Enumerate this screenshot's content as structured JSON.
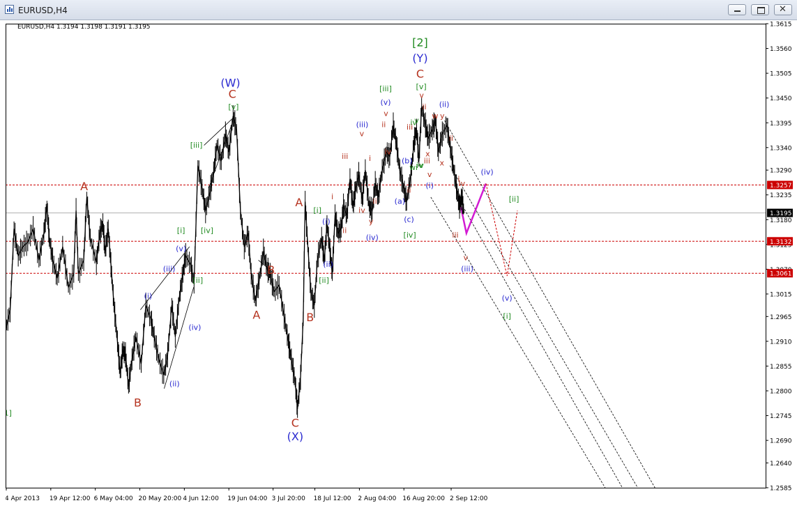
{
  "window": {
    "title": "EURUSD,H4"
  },
  "chart_header": {
    "label": "EURUSD,H4  1.3194 1.3198 1.3191 1.3195"
  },
  "colors": {
    "red": "#b5331f",
    "blue": "#2a2ad0",
    "green": "#228b22",
    "magenta": "#d21ad2",
    "price": "#000000",
    "hline": "#cc0000",
    "current": "#b0b0b0"
  },
  "chart_data": {
    "type": "line",
    "series": [
      {
        "values": [
          [
            0,
            1.2935
          ],
          [
            1.2,
            1.298
          ],
          [
            2.2,
            1.316
          ],
          [
            3.3,
            1.31
          ],
          [
            4.5,
            1.312
          ],
          [
            5.8,
            1.313
          ],
          [
            7.2,
            1.316
          ],
          [
            8.7,
            1.309
          ],
          [
            10.0,
            1.315
          ],
          [
            10.8,
            1.321
          ],
          [
            11.4,
            1.314
          ],
          [
            12.3,
            1.309
          ],
          [
            13.5,
            1.305
          ],
          [
            14.9,
            1.312
          ],
          [
            16.4,
            1.303
          ],
          [
            17.8,
            1.306
          ],
          [
            18.4,
            1.32
          ],
          [
            19.0,
            1.306
          ],
          [
            20.4,
            1.309
          ],
          [
            21.2,
            1.323
          ],
          [
            22.1,
            1.314
          ],
          [
            23.7,
            1.3085
          ],
          [
            24.6,
            1.315
          ],
          [
            25.4,
            1.317
          ],
          [
            26.0,
            1.311
          ],
          [
            26.8,
            1.316
          ],
          [
            27.5,
            1.308
          ],
          [
            28.3,
            1.299
          ],
          [
            29.2,
            1.291
          ],
          [
            29.9,
            1.284
          ],
          [
            30.6,
            1.289
          ],
          [
            31.3,
            1.288
          ],
          [
            32.1,
            1.281
          ],
          [
            33.0,
            1.287
          ],
          [
            34.0,
            1.292
          ],
          [
            35.4,
            1.286
          ],
          [
            36.6,
            1.299
          ],
          [
            37.9,
            1.296
          ],
          [
            38.8,
            1.292
          ],
          [
            40.0,
            1.287
          ],
          [
            41.3,
            1.2835
          ],
          [
            42.3,
            1.288
          ],
          [
            43.4,
            1.299
          ],
          [
            44.3,
            1.292
          ],
          [
            45.4,
            1.301
          ],
          [
            46.3,
            1.306
          ],
          [
            47.0,
            1.31
          ],
          [
            48.3,
            1.308
          ],
          [
            49.2,
            1.304
          ],
          [
            50.2,
            1.33
          ],
          [
            51.3,
            1.325
          ],
          [
            52.2,
            1.32
          ],
          [
            53.3,
            1.324
          ],
          [
            54.3,
            1.3285
          ],
          [
            55.2,
            1.3345
          ],
          [
            56.3,
            1.331
          ],
          [
            57.4,
            1.337
          ],
          [
            58.3,
            1.333
          ],
          [
            59.4,
            1.341
          ],
          [
            60.3,
            1.338
          ],
          [
            61.3,
            1.32
          ],
          [
            62.3,
            1.312
          ],
          [
            63.3,
            1.315
          ],
          [
            64.1,
            1.306
          ],
          [
            65.2,
            1.3
          ],
          [
            66.2,
            1.3045
          ],
          [
            67.3,
            1.311
          ],
          [
            68.3,
            1.307
          ],
          [
            69.1,
            1.306
          ],
          [
            70.1,
            1.302
          ],
          [
            71.4,
            1.3035
          ],
          [
            72.7,
            1.2965
          ],
          [
            73.8,
            1.291
          ],
          [
            74.6,
            1.287
          ],
          [
            75.6,
            1.282
          ],
          [
            76.2,
            1.276
          ],
          [
            77.0,
            1.283
          ],
          [
            77.7,
            1.296
          ],
          [
            78.2,
            1.322
          ],
          [
            78.9,
            1.312
          ],
          [
            79.7,
            1.302
          ],
          [
            80.6,
            1.299
          ],
          [
            81.4,
            1.309
          ],
          [
            82.5,
            1.314
          ],
          [
            83.2,
            1.309
          ],
          [
            83.9,
            1.317
          ],
          [
            84.7,
            1.311
          ],
          [
            85.3,
            1.306
          ],
          [
            86.0,
            1.319
          ],
          [
            86.8,
            1.315
          ],
          [
            87.6,
            1.316
          ],
          [
            88.2,
            1.321
          ],
          [
            89.1,
            1.319
          ],
          [
            89.9,
            1.327
          ],
          [
            90.7,
            1.321
          ],
          [
            91.3,
            1.3245
          ],
          [
            92.2,
            1.328
          ],
          [
            93.1,
            1.3225
          ],
          [
            93.9,
            1.329
          ],
          [
            94.9,
            1.321
          ],
          [
            95.7,
            1.32
          ],
          [
            96.5,
            1.326
          ],
          [
            97.3,
            1.323
          ],
          [
            98.3,
            1.329
          ],
          [
            99.4,
            1.333
          ],
          [
            100.3,
            1.332
          ],
          [
            101.2,
            1.339
          ],
          [
            102.0,
            1.335
          ],
          [
            102.9,
            1.329
          ],
          [
            103.9,
            1.325
          ],
          [
            104.7,
            1.322
          ],
          [
            105.8,
            1.328
          ],
          [
            106.6,
            1.335
          ],
          [
            107.3,
            1.338
          ],
          [
            107.9,
            1.331
          ],
          [
            108.6,
            1.343
          ],
          [
            109.6,
            1.339
          ],
          [
            110.3,
            1.336
          ],
          [
            111.4,
            1.338
          ],
          [
            112.2,
            1.34
          ],
          [
            113.0,
            1.333
          ],
          [
            114.0,
            1.337
          ],
          [
            115.2,
            1.339
          ],
          [
            116.1,
            1.334
          ],
          [
            117.0,
            1.329
          ],
          [
            117.9,
            1.324
          ],
          [
            118.5,
            1.321
          ],
          [
            119.1,
            1.323
          ],
          [
            119.7,
            1.3195
          ]
        ]
      }
    ],
    "ylim": [
      1.2585,
      1.3615
    ],
    "y_ticks": [
      "1.3615",
      "1.3560",
      "1.3505",
      "1.3450",
      "1.3395",
      "1.3340",
      "1.3290",
      "1.3235",
      "1.3180",
      "1.3125",
      "1.3070",
      "1.3015",
      "1.2965",
      "1.2910",
      "1.2855",
      "1.2800",
      "1.2745",
      "1.2690",
      "1.2640",
      "1.2585"
    ],
    "x_ticks": [
      "4 Apr 2013",
      "19 Apr 12:00",
      "6 May 04:00",
      "20 May 20:00",
      "4 Jun 12:00",
      "19 Jun 04:00",
      "3 Jul 20:00",
      "18 Jul 12:00",
      "2 Aug 04:00",
      "16 Aug 20:00",
      "2 Sep 12:00"
    ],
    "hlines": [
      {
        "value": 1.3257,
        "label": "1.3257"
      },
      {
        "value": 1.3132,
        "label": "1.3132"
      },
      {
        "value": 1.3061,
        "label": "1.3061"
      }
    ],
    "current_price": {
      "value": 1.3195,
      "label": "1.3195"
    },
    "wave_labels": [
      {
        "text": "[2]",
        "color": "green",
        "x": 108.2,
        "y": 1.3565
      },
      {
        "text": "(Y)",
        "color": "blue",
        "x": 108.2,
        "y": 1.353
      },
      {
        "text": "C",
        "color": "red",
        "x": 108.2,
        "y": 1.3495
      },
      {
        "text": "(W)",
        "color": "blue",
        "x": 58.7,
        "y": 1.3475
      },
      {
        "text": "C",
        "color": "red",
        "x": 59.2,
        "y": 1.345
      },
      {
        "text": "[v]",
        "color": "green",
        "x": 59.5,
        "y": 1.3425
      },
      {
        "text": "A",
        "color": "red",
        "x": 20.5,
        "y": 1.3245
      },
      {
        "text": "B",
        "color": "red",
        "x": 34.5,
        "y": 1.2765
      },
      {
        "text": "A",
        "color": "red",
        "x": 76.6,
        "y": 1.321
      },
      {
        "text": "B",
        "color": "red",
        "x": 69.3,
        "y": 1.306
      },
      {
        "text": "A",
        "color": "red",
        "x": 65.5,
        "y": 1.296
      },
      {
        "text": "B",
        "color": "red",
        "x": 79.5,
        "y": 1.2955
      },
      {
        "text": "C",
        "color": "red",
        "x": 75.6,
        "y": 1.272
      },
      {
        "text": "(X)",
        "color": "blue",
        "x": 75.6,
        "y": 1.269
      },
      {
        "text": "[iii]",
        "color": "green",
        "x": 49.8,
        "y": 1.334
      },
      {
        "text": "[iv]",
        "color": "green",
        "x": 52.6,
        "y": 1.315
      },
      {
        "text": "[i]",
        "color": "green",
        "x": 45.8,
        "y": 1.315
      },
      {
        "text": "[ii]",
        "color": "green",
        "x": 50.2,
        "y": 1.304
      },
      {
        "text": "(v)",
        "color": "blue",
        "x": 45.8,
        "y": 1.311
      },
      {
        "text": "(iii)",
        "color": "blue",
        "x": 42.7,
        "y": 1.3065
      },
      {
        "text": "(i)",
        "color": "blue",
        "x": 37.2,
        "y": 1.3005
      },
      {
        "text": "(iv)",
        "color": "blue",
        "x": 49.4,
        "y": 1.2935
      },
      {
        "text": "(ii)",
        "color": "blue",
        "x": 44.1,
        "y": 1.281
      },
      {
        "text": "1]",
        "color": "green",
        "x": 0.6,
        "y": 1.2745
      },
      {
        "text": "[i]",
        "color": "green",
        "x": 81.4,
        "y": 1.3195
      },
      {
        "text": "(i)",
        "color": "blue",
        "x": 83.7,
        "y": 1.317
      },
      {
        "text": "(ii)",
        "color": "blue",
        "x": 84.2,
        "y": 1.3075
      },
      {
        "text": "[ii]",
        "color": "green",
        "x": 83.1,
        "y": 1.304
      },
      {
        "text": "i",
        "color": "red",
        "x": 85.3,
        "y": 1.3225
      },
      {
        "text": "ii",
        "color": "red",
        "x": 88.5,
        "y": 1.315
      },
      {
        "text": "iii",
        "color": "red",
        "x": 88.6,
        "y": 1.3315
      },
      {
        "text": "iv",
        "color": "red",
        "x": 93.0,
        "y": 1.3195
      },
      {
        "text": "v",
        "color": "red",
        "x": 93.0,
        "y": 1.3365
      },
      {
        "text": "i",
        "color": "red",
        "x": 95.1,
        "y": 1.331
      },
      {
        "text": "ii",
        "color": "red",
        "x": 96.4,
        "y": 1.3215
      },
      {
        "text": "y",
        "color": "red",
        "x": 95.4,
        "y": 1.317
      },
      {
        "text": "(iii)",
        "color": "blue",
        "x": 93.1,
        "y": 1.3385
      },
      {
        "text": "(iv)",
        "color": "blue",
        "x": 95.7,
        "y": 1.3135
      },
      {
        "text": "ii",
        "color": "red",
        "x": 98.7,
        "y": 1.3385
      },
      {
        "text": "v",
        "color": "red",
        "x": 99.3,
        "y": 1.341
      },
      {
        "text": "(v)",
        "color": "blue",
        "x": 99.2,
        "y": 1.3435
      },
      {
        "text": "[iii]",
        "color": "green",
        "x": 99.2,
        "y": 1.3465
      },
      {
        "text": "iv",
        "color": "red",
        "x": 99.8,
        "y": 1.3325
      },
      {
        "text": "(a)",
        "color": "blue",
        "x": 102.9,
        "y": 1.3215
      },
      {
        "text": "(b)",
        "color": "blue",
        "x": 104.8,
        "y": 1.3305
      },
      {
        "text": "(c)",
        "color": "blue",
        "x": 105.3,
        "y": 1.3175
      },
      {
        "text": "[iv]",
        "color": "green",
        "x": 105.5,
        "y": 1.314
      },
      {
        "text": "ii",
        "color": "red",
        "x": 105.3,
        "y": 1.324
      },
      {
        "text": "iii",
        "color": "red",
        "x": 105.5,
        "y": 1.338
      },
      {
        "text": "iv",
        "color": "green",
        "x": 106.5,
        "y": 1.339
      },
      {
        "text": "v",
        "color": "green",
        "x": 107.3,
        "y": 1.3395
      },
      {
        "text": "wi",
        "color": "green",
        "x": 106.5,
        "y": 1.329
      },
      {
        "text": "iv",
        "color": "green",
        "x": 108.1,
        "y": 1.3295
      },
      {
        "text": "v",
        "color": "green",
        "x": 108.6,
        "y": 1.3295
      },
      {
        "text": "[v]",
        "color": "green",
        "x": 108.5,
        "y": 1.347
      },
      {
        "text": "v",
        "color": "red",
        "x": 108.6,
        "y": 1.345
      },
      {
        "text": "ii",
        "color": "red",
        "x": 109.3,
        "y": 1.3425
      },
      {
        "text": "w",
        "color": "red",
        "x": 112.1,
        "y": 1.3405
      },
      {
        "text": "y",
        "color": "red",
        "x": 114.0,
        "y": 1.3405
      },
      {
        "text": "(ii)",
        "color": "blue",
        "x": 114.5,
        "y": 1.343
      },
      {
        "text": "ii",
        "color": "red",
        "x": 116.3,
        "y": 1.3355
      },
      {
        "text": "x",
        "color": "red",
        "x": 113.9,
        "y": 1.33
      },
      {
        "text": "x",
        "color": "red",
        "x": 110.2,
        "y": 1.332
      },
      {
        "text": "iii",
        "color": "red",
        "x": 110.0,
        "y": 1.3305
      },
      {
        "text": "v",
        "color": "red",
        "x": 110.7,
        "y": 1.3275
      },
      {
        "text": "(i)",
        "color": "blue",
        "x": 110.7,
        "y": 1.325
      },
      {
        "text": "i",
        "color": "red",
        "x": 118.3,
        "y": 1.3265
      },
      {
        "text": "iv",
        "color": "red",
        "x": 119.1,
        "y": 1.3255
      },
      {
        "text": "iii",
        "color": "red",
        "x": 117.4,
        "y": 1.314
      },
      {
        "text": "v",
        "color": "red",
        "x": 120.1,
        "y": 1.309
      },
      {
        "text": "(iii)",
        "color": "blue",
        "x": 120.5,
        "y": 1.3065
      },
      {
        "text": "(iv)",
        "color": "blue",
        "x": 125.7,
        "y": 1.328
      },
      {
        "text": "[ii]",
        "color": "green",
        "x": 132.7,
        "y": 1.322
      },
      {
        "text": "(v)",
        "color": "blue",
        "x": 130.9,
        "y": 1.3
      },
      {
        "text": "[i]",
        "color": "green",
        "x": 130.9,
        "y": 1.296
      }
    ],
    "projection_solid": [
      [
        118.3,
        1.323
      ],
      [
        120.3,
        1.315
      ],
      [
        125.4,
        1.326
      ]
    ],
    "projection_dotted": [
      [
        125.4,
        1.326
      ],
      [
        130.9,
        1.3055
      ],
      [
        133.6,
        1.32
      ]
    ],
    "channel_lines": [
      [
        [
          114.6,
          1.34
        ],
        [
          169.5,
          1.2585
        ]
      ],
      [
        [
          116.0,
          1.33
        ],
        [
          165.0,
          1.2585
        ]
      ],
      [
        [
          111.0,
          1.323
        ],
        [
          156.5,
          1.2585
        ]
      ],
      [
        [
          118.0,
          1.323
        ],
        [
          161.0,
          1.2585
        ]
      ]
    ],
    "trend_lines": [
      [
        [
          35.2,
          1.298
        ],
        [
          48.0,
          1.312
        ]
      ],
      [
        [
          41.4,
          1.2805
        ],
        [
          49.1,
          1.303
        ]
      ],
      [
        [
          51.8,
          1.3345
        ],
        [
          59.3,
          1.3405
        ]
      ],
      [
        [
          53.0,
          1.325
        ],
        [
          59.2,
          1.3395
        ]
      ],
      [
        [
          66.0,
          1.309
        ],
        [
          69.5,
          1.3065
        ]
      ]
    ],
    "x_range": [
      0,
      198.4
    ]
  }
}
